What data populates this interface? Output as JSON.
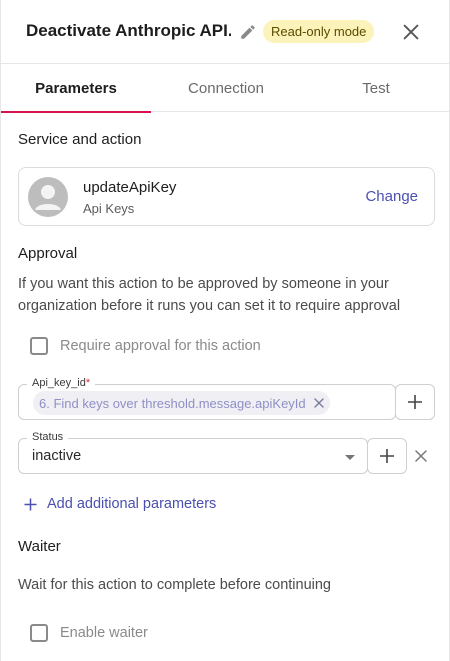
{
  "header": {
    "title": "Deactivate Anthropic API...",
    "badge": "Read-only mode"
  },
  "tabs": [
    {
      "label": "Parameters",
      "active": true
    },
    {
      "label": "Connection",
      "active": false
    },
    {
      "label": "Test",
      "active": false
    }
  ],
  "service": {
    "section_title": "Service and action",
    "action_name": "updateApiKey",
    "service_name": "Api Keys",
    "change_label": "Change"
  },
  "approval": {
    "section_title": "Approval",
    "description": "If you want this action to be approved by someone in your organization before it runs you can set it to require approval",
    "checkbox_label": "Require approval for this action"
  },
  "fields": {
    "api_key": {
      "label": "Api_key_id",
      "required_mark": "*",
      "chip_value": "6. Find keys over threshold.message.apiKeyId"
    },
    "status": {
      "label": "Status",
      "value": "inactive"
    }
  },
  "add_params_label": "Add additional parameters",
  "waiter": {
    "section_title": "Waiter",
    "description": "Wait for this action to complete before continuing",
    "checkbox_label": "Enable waiter"
  },
  "colors": {
    "accent": "#d9124d",
    "link": "#4a4fb0",
    "badge_bg": "#fbf3b9"
  },
  "icons": [
    "pencil-icon",
    "close-icon",
    "avatar-icon",
    "plus-icon",
    "chevron-down-icon"
  ]
}
